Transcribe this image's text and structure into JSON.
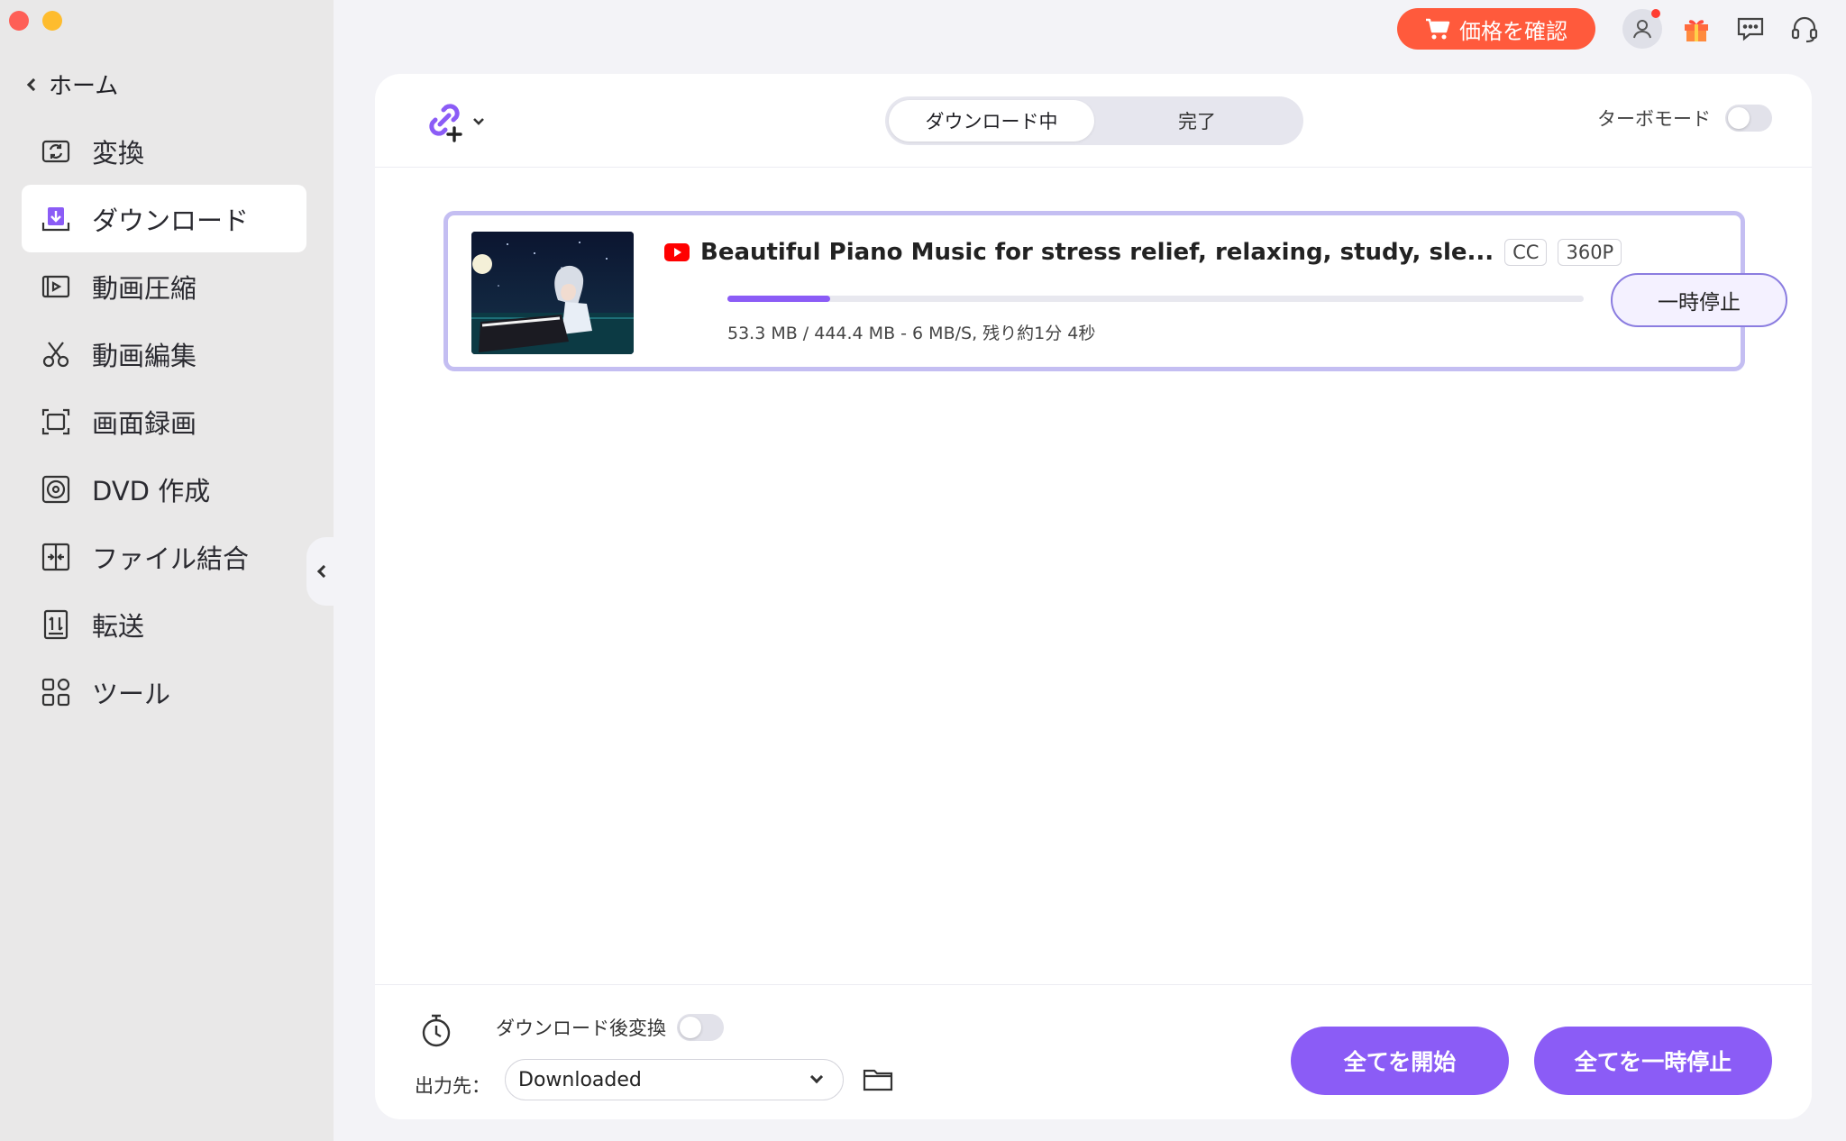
{
  "sidebar": {
    "home_label": "ホーム",
    "items": [
      {
        "label": "変換",
        "icon": "convert-icon"
      },
      {
        "label": "ダウンロード",
        "icon": "download-icon",
        "active": true
      },
      {
        "label": "動画圧縮",
        "icon": "compress-icon"
      },
      {
        "label": "動画編集",
        "icon": "scissors-icon"
      },
      {
        "label": "画面録画",
        "icon": "screen-record-icon"
      },
      {
        "label": "DVD 作成",
        "icon": "dvd-icon"
      },
      {
        "label": "ファイル結合",
        "icon": "merge-icon"
      },
      {
        "label": "転送",
        "icon": "transfer-icon"
      },
      {
        "label": "ツール",
        "icon": "tools-icon"
      }
    ]
  },
  "topbar": {
    "price_label": "価格を確認",
    "accent": "#ff5a3c"
  },
  "header": {
    "tabs": [
      {
        "label": "ダウンロード中",
        "active": true
      },
      {
        "label": "完了",
        "active": false
      }
    ],
    "turbo_label": "ターボモード",
    "turbo_on": false
  },
  "download": {
    "title": "Beautiful Piano Music for stress relief, relaxing, study, sle...",
    "badges": [
      "CC",
      "360P"
    ],
    "progress": 0.12,
    "info": "53.3 MB / 444.4 MB - 6 MB/S, 残り約1分 4秒",
    "pause_label": "一時停止"
  },
  "footer": {
    "after_convert_label": "ダウンロード後変換",
    "after_convert_on": false,
    "output_label": "出力先：",
    "output_value": "Downloaded",
    "start_all_label": "全てを開始",
    "pause_all_label": "全てを一時停止"
  },
  "colors": {
    "primary": "#8b5cf6",
    "card_border": "#c4bef2"
  }
}
